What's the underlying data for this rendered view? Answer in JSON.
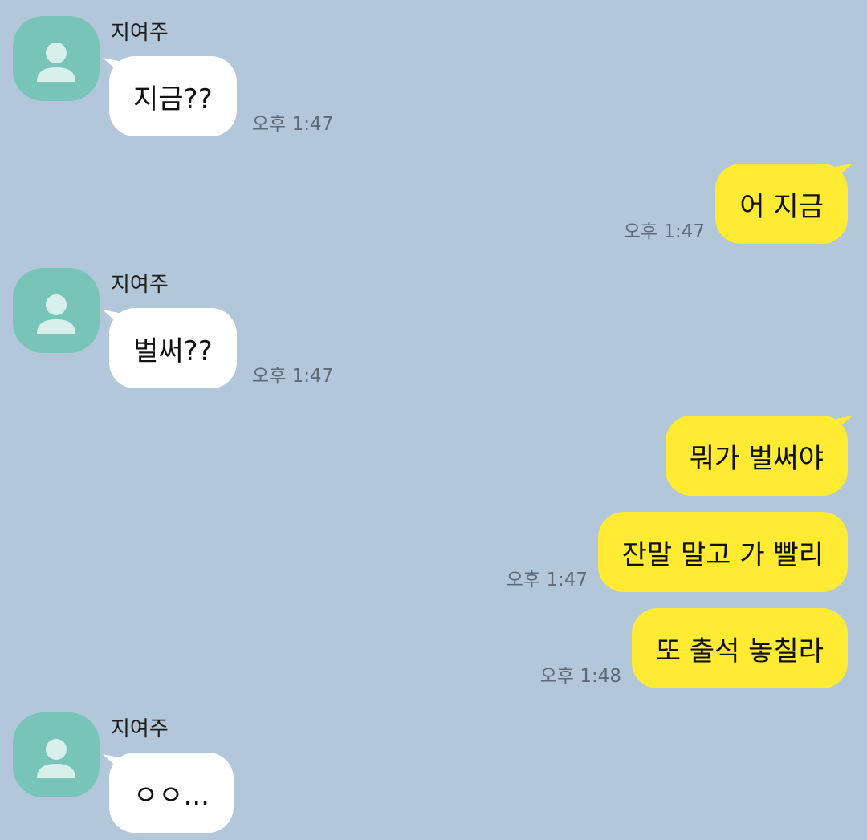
{
  "chat": {
    "messages": [
      {
        "sender": "지여주",
        "text": "지금??",
        "time": "오후 1:47"
      },
      {
        "text": "어 지금",
        "time": "오후 1:47"
      },
      {
        "sender": "지여주",
        "text": "벌써??",
        "time": "오후 1:47"
      },
      {
        "text": "뭐가 벌써야"
      },
      {
        "text": "잔말 말고 가 빨리",
        "time": "오후 1:47"
      },
      {
        "text": "또 출석 놓칠라",
        "time": "오후 1:48"
      },
      {
        "sender": "지여주",
        "text": "ㅇㅇ..."
      }
    ]
  },
  "colors": {
    "background": "#b2c7da",
    "incoming_bubble": "#ffffff",
    "outgoing_bubble": "#ffeb33",
    "avatar": "#79c4b8"
  },
  "icons": {
    "avatar": "default-profile-icon"
  }
}
